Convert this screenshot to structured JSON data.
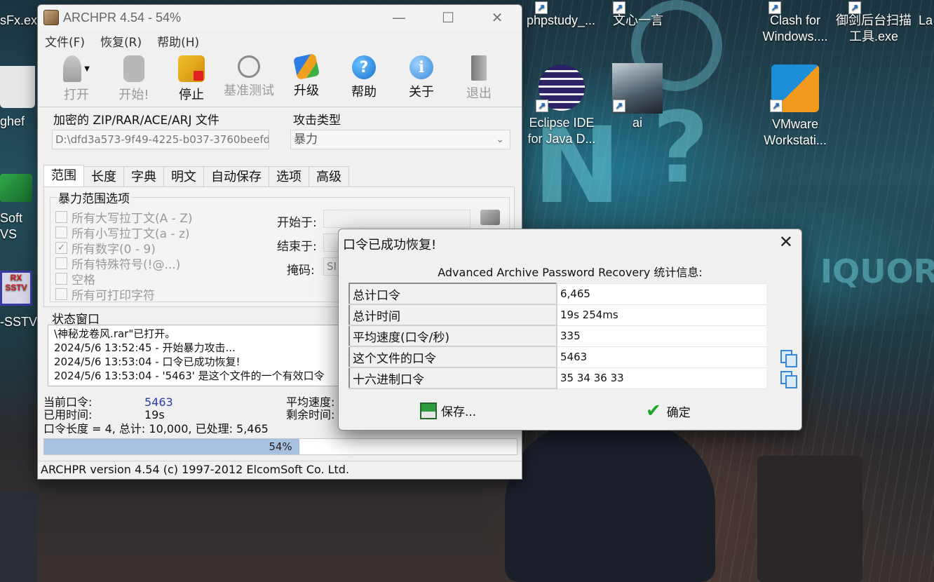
{
  "desktop": {
    "icons": [
      {
        "id": "sfx",
        "label": "sFx.exe"
      },
      {
        "id": "phpstudy",
        "label": "phpstudy_..."
      },
      {
        "id": "wenxin",
        "label": "文心一言"
      },
      {
        "id": "clash",
        "label": "Clash for Windows...."
      },
      {
        "id": "yujian",
        "label": "御剑后台扫描工具.exe"
      },
      {
        "id": "la",
        "label": "La"
      },
      {
        "id": "eclipse",
        "label": "Eclipse IDE for Java D..."
      },
      {
        "id": "ai",
        "label": "ai"
      },
      {
        "id": "vmware",
        "label": "VMware Workstati..."
      },
      {
        "id": "ghef",
        "label": "ghef"
      },
      {
        "id": "softvs",
        "label": "Soft VS"
      },
      {
        "id": "sstv",
        "label": "-SSTV"
      }
    ],
    "sstv_badge": "RX\nSSTV"
  },
  "window": {
    "title": "ARCHPR 4.54 - 54%",
    "menu": [
      "文件(F)",
      "恢复(R)",
      "帮助(H)"
    ],
    "toolbar": [
      {
        "label": "打开",
        "enabled": false
      },
      {
        "label": "开始!",
        "enabled": false
      },
      {
        "label": "停止",
        "enabled": true
      },
      {
        "label": "基准测试",
        "enabled": false
      },
      {
        "label": "升级",
        "enabled": true
      },
      {
        "label": "帮助",
        "enabled": true
      },
      {
        "label": "关于",
        "enabled": true
      },
      {
        "label": "退出",
        "enabled": false
      }
    ],
    "file_section_label": "加密的 ZIP/RAR/ACE/ARJ 文件",
    "file_path": "D:\\dfd3a573-9f49-4225-b037-3760beefd4",
    "attack_type_label": "攻击类型",
    "attack_type_value": "暴力",
    "tabs": [
      "范围",
      "长度",
      "字典",
      "明文",
      "自动保存",
      "选项",
      "高级"
    ],
    "range": {
      "group_label": "暴力范围选项",
      "options": [
        {
          "label": "所有大写拉丁文(A - Z)",
          "checked": false
        },
        {
          "label": "所有小写拉丁文(a - z)",
          "checked": false
        },
        {
          "label": "所有数字(0 - 9)",
          "checked": true
        },
        {
          "label": "所有特殊符号(!@...)",
          "checked": false
        },
        {
          "label": "空格",
          "checked": false
        },
        {
          "label": "所有可打印字符",
          "checked": false
        }
      ],
      "start_label": "开始于:",
      "end_label": "结束于:",
      "mask_label": "掩码:",
      "mask_value": "SI"
    },
    "status_label": "状态窗口",
    "status_lines": [
      "\\神秘龙卷风.rar\"已打开。",
      "2024/5/6 13:52:45 - 开始暴力攻击...",
      "2024/5/6 13:53:04 - 口令已成功恢复!",
      "2024/5/6 13:53:04 - '5463' 是这个文件的一个有效口令"
    ],
    "current_password_label": "当前口令:",
    "current_password_value": "5463",
    "elapsed_label": "已用时间:",
    "elapsed_value": "19s",
    "avg_speed_label": "平均速度:",
    "remaining_label": "剩余时间:",
    "summary_line": "口令长度 = 4, 总计: 10,000, 已处理: 5,465",
    "progress_text": "54%",
    "progress_fraction": 0.54,
    "statusbar": "ARCHPR version 4.54 (c) 1997-2012 ElcomSoft Co. Ltd."
  },
  "dialog": {
    "title": "口令已成功恢复!",
    "close": "✕",
    "header": "Advanced Archive Password Recovery 统计信息:",
    "rows": [
      {
        "key": "总计口令",
        "value": "6,465"
      },
      {
        "key": "总计时间",
        "value": "19s 254ms"
      },
      {
        "key": "平均速度(口令/秒)",
        "value": "335"
      },
      {
        "key": "这个文件的口令",
        "value": "5463"
      },
      {
        "key": "十六进制口令",
        "value": "35 34 36 33"
      }
    ],
    "save_label": "保存...",
    "ok_label": "确定"
  }
}
